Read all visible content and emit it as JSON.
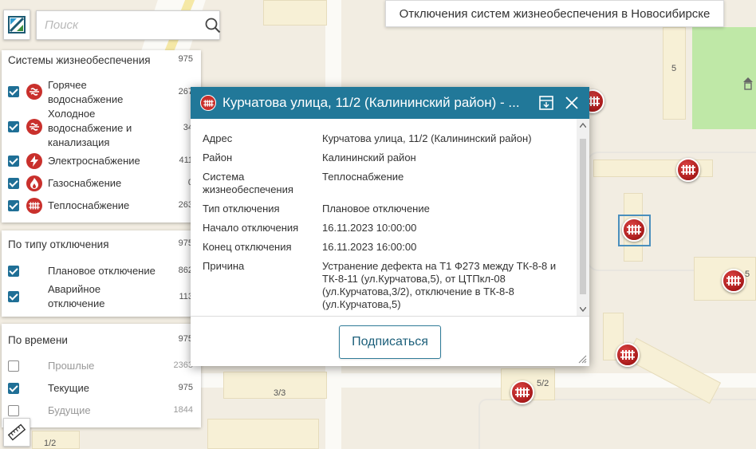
{
  "header": {
    "search_placeholder": "Поиск",
    "title": "Отключения систем жизнеобеспечения в Новосибирске"
  },
  "map": {
    "labels": [
      "5",
      "5",
      "3/3",
      "5/2",
      "1/2"
    ]
  },
  "filters": {
    "systems": {
      "title": "Системы жизнеобеспечения",
      "count": "975",
      "items": [
        {
          "label": "Горячее водоснабжение",
          "count": "267",
          "checked": true,
          "icon": "hot-water-icon"
        },
        {
          "label": "Холодное водоснабжение и канализация",
          "count": "34",
          "checked": true,
          "icon": "cold-water-icon"
        },
        {
          "label": "Электроснабжение",
          "count": "411",
          "checked": true,
          "icon": "lightning-icon"
        },
        {
          "label": "Газоснабжение",
          "count": "0",
          "checked": true,
          "icon": "gas-flame-icon"
        },
        {
          "label": "Теплоснабжение",
          "count": "263",
          "checked": true,
          "icon": "radiator-icon"
        }
      ]
    },
    "types": {
      "title": "По типу отключения",
      "count": "975",
      "items": [
        {
          "label": "Плановое отключение",
          "count": "862",
          "checked": true
        },
        {
          "label": "Аварийное отключение",
          "count": "113",
          "checked": true
        }
      ]
    },
    "time": {
      "title": "По времени",
      "count": "975",
      "items": [
        {
          "label": "Прошлые",
          "count": "2363",
          "checked": false
        },
        {
          "label": "Текущие",
          "count": "975",
          "checked": true
        },
        {
          "label": "Будущие",
          "count": "1844",
          "checked": false
        }
      ]
    }
  },
  "popup": {
    "title": "Курчатова улица, 11/2 (Калининский район) - ...",
    "rows": [
      {
        "key": "Адрес",
        "value": "Курчатова улица, 11/2 (Калининский район)"
      },
      {
        "key": "Район",
        "value": "Калининский район"
      },
      {
        "key": "Система жизнеобеспечения",
        "value": "Теплоснабжение"
      },
      {
        "key": "Тип отключения",
        "value": "Плановое отключение"
      },
      {
        "key": "Начало отключения",
        "value": "16.11.2023 10:00:00"
      },
      {
        "key": "Конец отключения",
        "value": "16.11.2023 16:00:00"
      },
      {
        "key": "Причина",
        "value": "Устранение дефекта на Т1 Ф273 между ТК-8-8 и ТК-8-11 (ул.Курчатова,5), от ЦТПкл-08 (ул.Курчатова,3/2), отключение в ТК-8-8 (ул.Курчатова,5)"
      }
    ],
    "subscribe_label": "Подписаться"
  },
  "colors": {
    "accent": "#217899",
    "marker": "#c9302c",
    "checkbox": "#1f6f96"
  }
}
